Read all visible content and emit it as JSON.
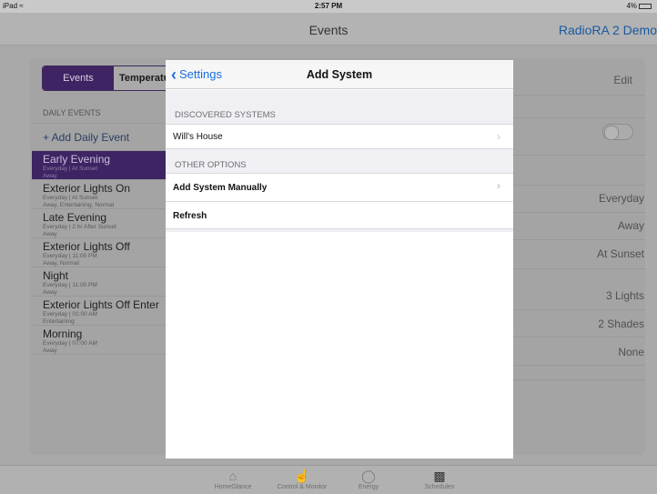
{
  "status_bar": {
    "device": "iPad",
    "wifi_icon": "wifi-icon",
    "time": "2:57 PM",
    "battery": "4%"
  },
  "nav": {
    "title": "Events",
    "right_label": "RadioRA 2 Demo"
  },
  "segment": {
    "active": "Events",
    "inactive": "Temperatu"
  },
  "events_list": {
    "section_title": "DAILY EVENTS",
    "add_label": "+ Add Daily Event",
    "items": [
      {
        "title": "Early Evening",
        "line1": "Everyday | At Sunset",
        "line2": "Away"
      },
      {
        "title": "Exterior Lights On",
        "line1": "Everyday | At Sunset",
        "line2": "Away, Entertaining, Normal"
      },
      {
        "title": "Late Evening",
        "line1": "Everyday | 2 hr After Sunset",
        "line2": "Away"
      },
      {
        "title": "Exterior Lights Off",
        "line1": "Everyday | 11:00 PM",
        "line2": "Away, Normal"
      },
      {
        "title": "Night",
        "line1": "Everyday | 11:00 PM",
        "line2": "Away"
      },
      {
        "title": "Exterior Lights Off Enter",
        "line1": "Everyday | 01:00 AM",
        "line2": "Entertaining"
      },
      {
        "title": "Morning",
        "line1": "Everyday | 07:00 AM",
        "line2": "Away"
      }
    ]
  },
  "detail": {
    "edit_label": "Edit",
    "values": [
      "Everyday",
      "Away",
      "At Sunset",
      "3 Lights",
      "2 Shades",
      "None"
    ]
  },
  "tabs": [
    {
      "label": "HomeGlance",
      "icon": "home-icon"
    },
    {
      "label": "Control & Monitor",
      "icon": "hand-icon"
    },
    {
      "label": "Energy",
      "icon": "energy-icon"
    },
    {
      "label": "Schedules",
      "icon": "clapper-icon"
    }
  ],
  "modal": {
    "back_label": "Settings",
    "title": "Add System",
    "discovered_header": "DISCOVERED SYSTEMS",
    "discovered_items": [
      "Will's House"
    ],
    "options_header": "OTHER OPTIONS",
    "option_items": [
      "Add System Manually",
      "Refresh"
    ]
  },
  "colors": {
    "accent": "#3e2462",
    "link": "#1a6ee0",
    "nav_link": "#1a5aa0"
  }
}
